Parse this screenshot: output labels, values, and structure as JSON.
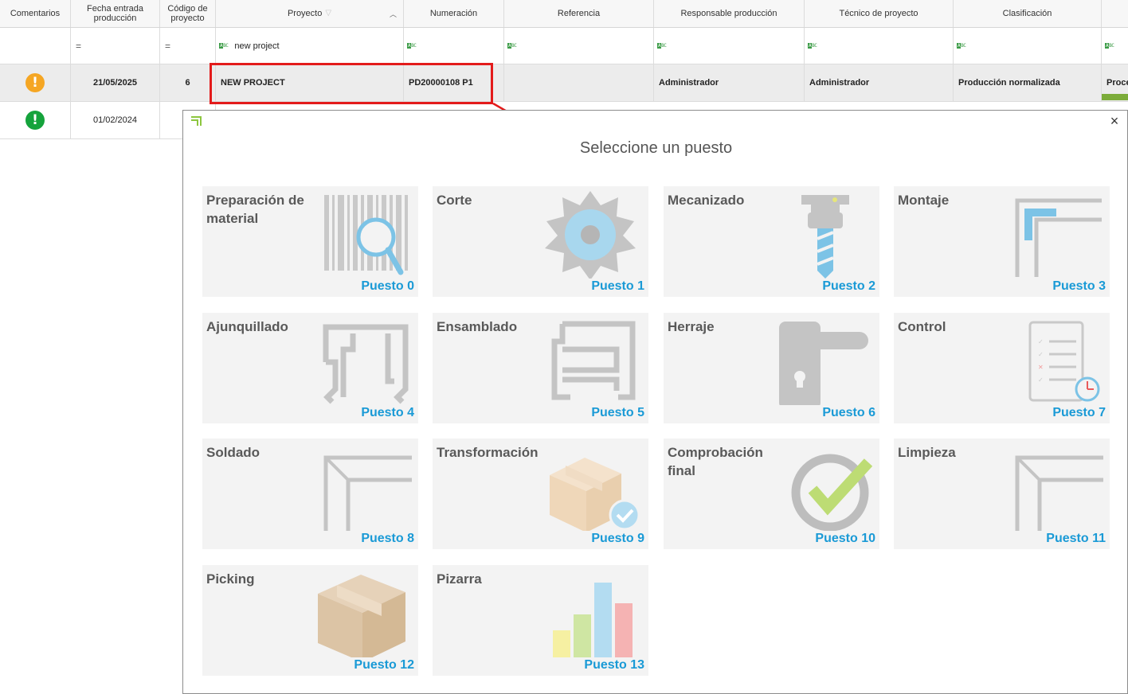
{
  "columns": [
    {
      "label": "Comentarios"
    },
    {
      "label": "Fecha entrada\nproducción"
    },
    {
      "label": "Código de\nproyecto"
    },
    {
      "label": "Proyecto"
    },
    {
      "label": "Numeración"
    },
    {
      "label": "Referencia"
    },
    {
      "label": "Responsable producción"
    },
    {
      "label": "Técnico de proyecto"
    },
    {
      "label": "Clasificación"
    }
  ],
  "filters": {
    "eq_symbol": "=",
    "abc_symbol": "ABC",
    "project_value": "new project"
  },
  "rows": [
    {
      "status": "warning",
      "status_glyph": "!",
      "fecha": "21/05/2025",
      "codigo": "6",
      "proyecto": "NEW PROJECT",
      "numeracion": "PD20000108 P1",
      "referencia": "",
      "responsable": "Administrador",
      "tecnico": "Administrador",
      "clasificacion": "Producción normalizada",
      "extra": "Proce"
    },
    {
      "status": "ok",
      "status_glyph": "!",
      "fecha": "01/02/2024"
    }
  ],
  "colors": {
    "warning": "#f5a623",
    "ok": "#15a33c",
    "highlight": "#e31b1b",
    "puesto_text": "#1a9ad6"
  },
  "modal": {
    "title": "Seleccione un puesto",
    "close_glyph": "×",
    "tiles": [
      {
        "name": "Preparación de material",
        "puesto": "Puesto 0",
        "icon": "barcode-magnifier-icon"
      },
      {
        "name": "Corte",
        "puesto": "Puesto 1",
        "icon": "saw-blade-icon"
      },
      {
        "name": "Mecanizado",
        "puesto": "Puesto 2",
        "icon": "drill-bit-icon"
      },
      {
        "name": "Montaje",
        "puesto": "Puesto 3",
        "icon": "frame-corner-icon"
      },
      {
        "name": "Ajunquillado",
        "puesto": "Puesto 4",
        "icon": "glazing-bead-icon"
      },
      {
        "name": "Ensamblado",
        "puesto": "Puesto 5",
        "icon": "assembly-frame-icon"
      },
      {
        "name": "Herraje",
        "puesto": "Puesto 6",
        "icon": "door-handle-icon"
      },
      {
        "name": "Control",
        "puesto": "Puesto 7",
        "icon": "checklist-clock-icon"
      },
      {
        "name": "Soldado",
        "puesto": "Puesto 8",
        "icon": "profile-corner-icon"
      },
      {
        "name": "Transformación",
        "puesto": "Puesto 9",
        "icon": "box-check-icon"
      },
      {
        "name": "Comprobación final",
        "puesto": "Puesto 10",
        "icon": "check-circle-icon"
      },
      {
        "name": "Limpieza",
        "puesto": "Puesto 11",
        "icon": "profile-corner-icon"
      },
      {
        "name": "Picking",
        "puesto": "Puesto 12",
        "icon": "cardboard-box-icon"
      },
      {
        "name": "Pizarra",
        "puesto": "Puesto 13",
        "icon": "bar-chart-icon"
      }
    ]
  }
}
